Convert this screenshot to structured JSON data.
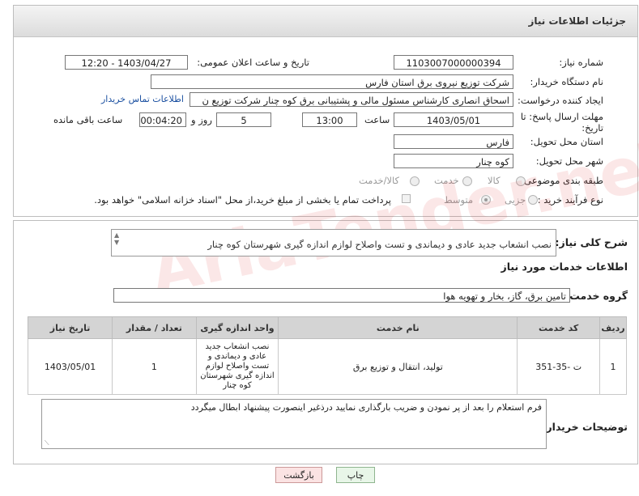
{
  "header": {
    "title": "جزئیات اطلاعات نیاز"
  },
  "form": {
    "need_number_label": "شماره نیاز:",
    "need_number": "1103007000000394",
    "announce_label": "تاریخ و ساعت اعلان عمومی:",
    "announce_value": "1403/04/27 - 12:20",
    "buyer_org_label": "نام دستگاه خریدار:",
    "buyer_org": "شرکت توزیع نیروی برق استان فارس",
    "creator_label": "ایجاد کننده درخواست:",
    "creator": "اسحاق انصاری کارشناس مسئول مالی و پشتیبانی برق کوه چنار شرکت توزیع ن",
    "contact_link": "اطلاعات تماس خریدار",
    "deadline_label": "مهلت ارسال پاسخ: تا تاریخ:",
    "deadline_date": "1403/05/01",
    "time_label": "ساعت",
    "deadline_time": "13:00",
    "days_value": "5",
    "days_label": "روز و",
    "remaining_time": "00:04:20",
    "remaining_label": "ساعت باقی مانده",
    "province_label": "استان محل تحویل:",
    "province": "فارس",
    "city_label": "شهر محل تحویل:",
    "city": "کوه چنار",
    "category_label": "طبقه بندی موضوعی:",
    "category_options": [
      "کالا",
      "خدمت",
      "کالا/خدمت"
    ],
    "process_label": "نوع فرآیند خرید :",
    "process_options": [
      "جزیی",
      "متوسط"
    ],
    "payment_note": "پرداخت تمام یا بخشی از مبلغ خرید،از محل \"اسناد خزانه اسلامی\" خواهد بود."
  },
  "summary": {
    "label": "شرح کلی نیاز:",
    "text": "نصب انشعاب جدید عادی و دیماندی و تست واصلاح لوازم اندازه گیری شهرستان کوه چنار"
  },
  "services": {
    "title": "اطلاعات خدمات مورد نیاز",
    "group_label": "گروه خدمت:",
    "group_value": "تامین برق، گاز، بخار و تهویه هوا",
    "columns": [
      "ردیف",
      "کد خدمت",
      "نام خدمت",
      "واحد اندازه گیری",
      "تعداد / مقدار",
      "تاریخ نیاز"
    ],
    "rows": [
      [
        "1",
        "ت -35-351",
        "تولید، انتقال و توزیع برق",
        "نصب انشعاب جدید عادی و دیماندی و تست واصلاح لوازم اندازه گیری شهرستان کوه چنار",
        "1",
        "1403/05/01"
      ]
    ]
  },
  "buyer_notes": {
    "label": "توضیحات خریدار:",
    "text": "فرم استعلام را بعد از پر نمودن و ضریب بارگذاری نمایید درذغیر اینصورت پیشنهاد ابطال میگردد"
  },
  "buttons": {
    "print": "چاپ",
    "back": "بازگشت"
  },
  "watermark": "AriaTender.neT"
}
